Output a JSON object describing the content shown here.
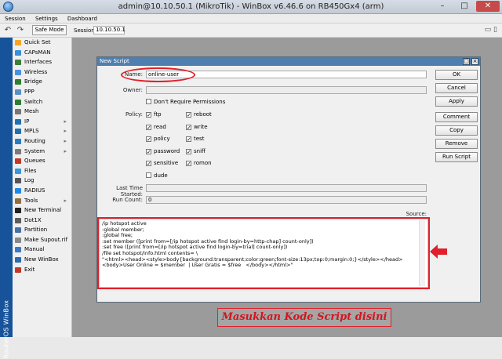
{
  "window": {
    "title": "admin@10.10.50.1 (MikroTik) - WinBox v6.46.6 on RB450Gx4 (arm)",
    "minimize": "–",
    "maximize": "□",
    "close": "✕"
  },
  "menu": {
    "items": [
      "Session",
      "Settings",
      "Dashboard"
    ]
  },
  "toolbar": {
    "undo_icon": "↶",
    "redo_icon": "↷",
    "safe_mode": "Safe Mode",
    "session_label": "Session:",
    "session_value": "10.10.50.1",
    "right_icons": "▭ ▯"
  },
  "brand": {
    "text": "RouterOS WinBox"
  },
  "sidebar": {
    "items": [
      {
        "label": "Quick Set",
        "color": "#f5a623",
        "submenu": false
      },
      {
        "label": "CAPsMAN",
        "color": "#3a8fd9",
        "submenu": false
      },
      {
        "label": "Interfaces",
        "color": "#3d7d3d",
        "submenu": false
      },
      {
        "label": "Wireless",
        "color": "#4a90e2",
        "submenu": false
      },
      {
        "label": "Bridge",
        "color": "#2e7d32",
        "submenu": false
      },
      {
        "label": "PPP",
        "color": "#5b8fc7",
        "submenu": false
      },
      {
        "label": "Switch",
        "color": "#2e7d32",
        "submenu": false
      },
      {
        "label": "Mesh",
        "color": "#777777",
        "submenu": false
      },
      {
        "label": "IP",
        "color": "#1f6fb3",
        "submenu": true
      },
      {
        "label": "MPLS",
        "color": "#1f6fb3",
        "submenu": true
      },
      {
        "label": "Routing",
        "color": "#2b7bbf",
        "submenu": true
      },
      {
        "label": "System",
        "color": "#7a7a7a",
        "submenu": true
      },
      {
        "label": "Queues",
        "color": "#c0392b",
        "submenu": false
      },
      {
        "label": "Files",
        "color": "#3498db",
        "submenu": false
      },
      {
        "label": "Log",
        "color": "#555555",
        "submenu": false
      },
      {
        "label": "RADIUS",
        "color": "#1e88e5",
        "submenu": false
      },
      {
        "label": "Tools",
        "color": "#8e6e3d",
        "submenu": true
      },
      {
        "label": "New Terminal",
        "color": "#222222",
        "submenu": false
      },
      {
        "label": "Dot1X",
        "color": "#5c5c5c",
        "submenu": false
      },
      {
        "label": "Partition",
        "color": "#4a6fa5",
        "submenu": false
      },
      {
        "label": "Make Supout.rif",
        "color": "#888888",
        "submenu": false
      },
      {
        "label": "Manual",
        "color": "#3a78c3",
        "submenu": false
      },
      {
        "label": "New WinBox",
        "color": "#2b6cb0",
        "submenu": false
      },
      {
        "label": "Exit",
        "color": "#c0392b",
        "submenu": false
      }
    ]
  },
  "script_window": {
    "title": "New Script",
    "name_label": "Name:",
    "name_value": "online-user",
    "owner_label": "Owner:",
    "owner_value": "",
    "dont_require_label": "Don't Require Permissions",
    "policy_label": "Policy:",
    "policies": [
      {
        "label": "ftp",
        "checked": true
      },
      {
        "label": "reboot",
        "checked": true
      },
      {
        "label": "read",
        "checked": true
      },
      {
        "label": "write",
        "checked": true
      },
      {
        "label": "policy",
        "checked": true
      },
      {
        "label": "test",
        "checked": true
      },
      {
        "label": "password",
        "checked": true
      },
      {
        "label": "sniff",
        "checked": true
      },
      {
        "label": "sensitive",
        "checked": true
      },
      {
        "label": "romon",
        "checked": true
      },
      {
        "label": "dude",
        "checked": false
      }
    ],
    "last_started_label": "Last Time Started:",
    "last_started_value": "",
    "run_count_label": "Run Count:",
    "run_count_value": "0",
    "source_label": "Source:",
    "source": "/ip hotspot active\n:global member;\n:global free;\n:set member ([print from=[/ip hotspot active find login-by=http-chap] count-only])\n:set free ([print from=[/ip hotspot active find login-by=trial] count-only])\n/file set hotspot/info.html contents= \\\n\"<html><head><style>body{background:transparent;color:green;font-size:13px;top:0;margin:0;}</style></head><body>User Online = $member  | User Gratis = $free   </body></html>\"",
    "buttons": {
      "ok": "OK",
      "cancel": "Cancel",
      "apply": "Apply",
      "comment": "Comment",
      "copy": "Copy",
      "remove": "Remove",
      "run_script": "Run Script"
    }
  },
  "annotation": {
    "caption": "Masukkan Kode Script disini",
    "color": "#e0212b"
  }
}
